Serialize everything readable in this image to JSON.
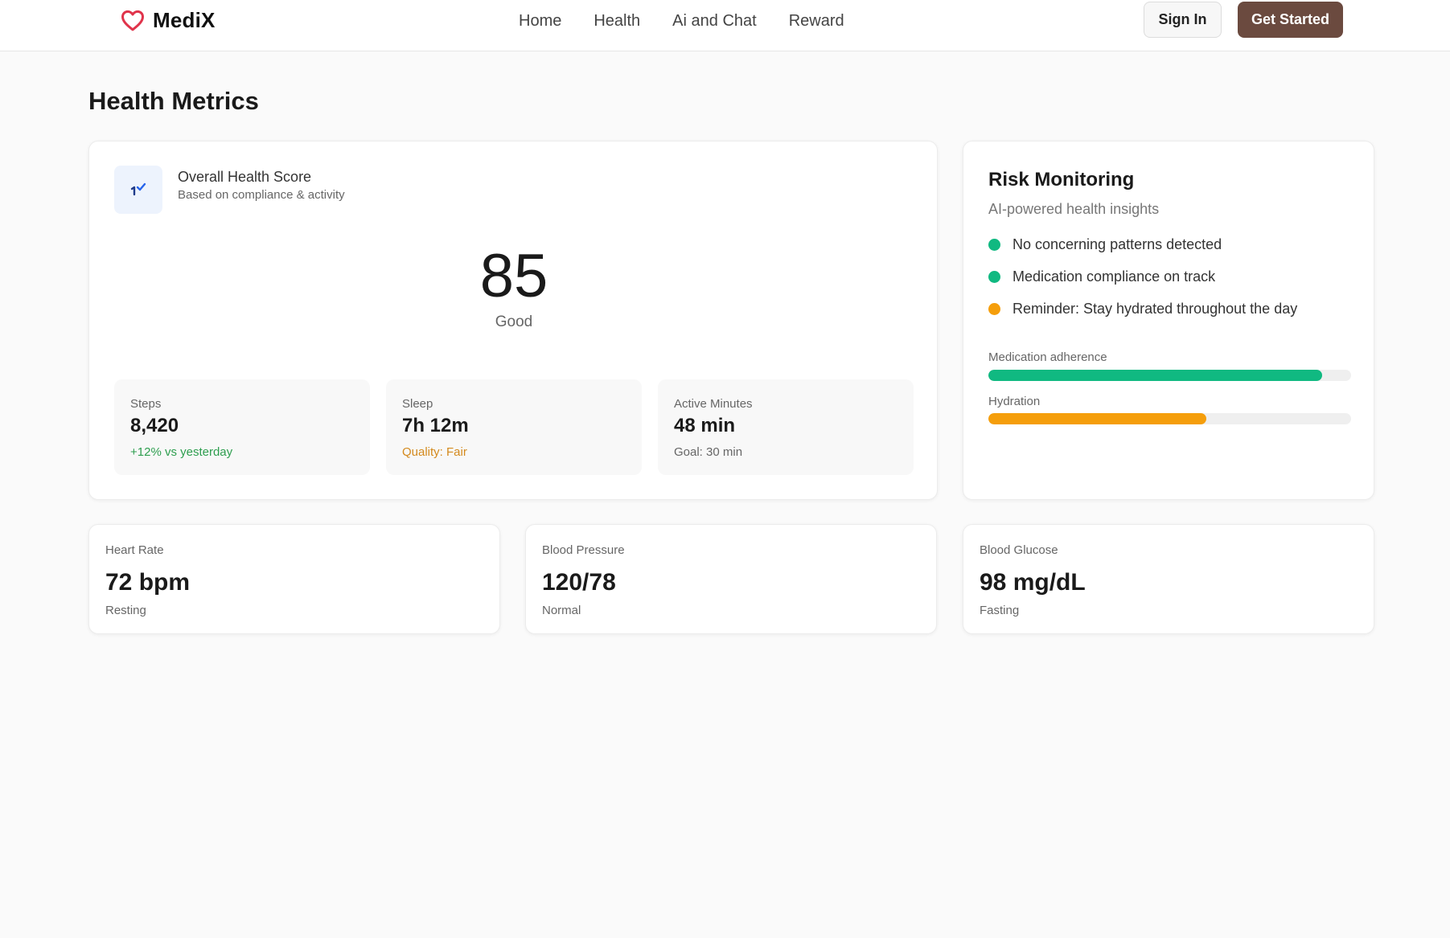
{
  "header": {
    "brand": "MediX",
    "logo_icon": "heart-icon",
    "nav": [
      "Home",
      "Health",
      "Ai and Chat",
      "Reward"
    ],
    "sign_in": "Sign In",
    "get_started": "Get Started"
  },
  "page": {
    "title": "Health Metrics"
  },
  "score_card": {
    "icon": "trend-check-icon",
    "title": "Overall Health Score",
    "subtitle": "Based on compliance & activity",
    "score": "85",
    "score_label": "Good",
    "stats": [
      {
        "label": "Steps",
        "value": "8,420",
        "note": "+12% vs yesterday",
        "note_color": "#2e9e4f"
      },
      {
        "label": "Sleep",
        "value": "7h 12m",
        "note": "Quality: Fair",
        "note_color": "#d48a1e"
      },
      {
        "label": "Active Minutes",
        "value": "48 min",
        "note": "Goal: 30 min",
        "note_color": "#666666"
      }
    ]
  },
  "risk_card": {
    "title": "Risk Monitoring",
    "subtitle": "AI-powered health insights",
    "items": [
      {
        "text": "No concerning patterns detected",
        "color": "#10b981"
      },
      {
        "text": "Medication compliance on track",
        "color": "#10b981"
      },
      {
        "text": "Reminder: Stay hydrated throughout the day",
        "color": "#f59e0b"
      }
    ],
    "bars": [
      {
        "label": "Medication adherence",
        "fraction": 0.92,
        "color": "#10b981"
      },
      {
        "label": "Hydration",
        "fraction": 0.6,
        "color": "#f59e0b"
      }
    ]
  },
  "vitals": [
    {
      "label": "Heart Rate",
      "value": "72 bpm",
      "note": "Resting"
    },
    {
      "label": "Blood Pressure",
      "value": "120/78",
      "note": "Normal"
    },
    {
      "label": "Blood Glucose",
      "value": "98 mg/dL",
      "note": "Fasting"
    }
  ],
  "colors": {
    "primary_button": "#6b4a3f",
    "heart": "#e0344b",
    "icon_blue": "#2563eb"
  }
}
